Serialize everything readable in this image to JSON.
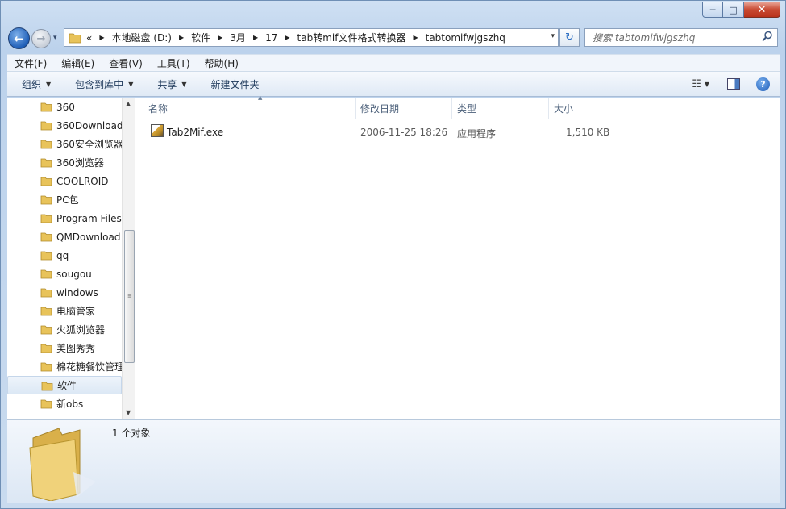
{
  "titlebar": {
    "min_label": "─",
    "max_label": "□",
    "close_label": "✕"
  },
  "nav": {
    "back_glyph": "←",
    "forward_glyph": "→",
    "history_glyph": "▾",
    "refresh_glyph": "↻",
    "address_dropdown_glyph": "▾",
    "address_prefix": "«",
    "breadcrumbs": [
      "本地磁盘 (D:)",
      "软件",
      "3月",
      "17",
      "tab转mif文件格式转换器",
      "tabtomifwjgszhq"
    ],
    "search_placeholder": "搜索 tabtomifwjgszhq",
    "search_icon": "magnifier-icon"
  },
  "menubar": {
    "items": [
      "文件(F)",
      "编辑(E)",
      "查看(V)",
      "工具(T)",
      "帮助(H)"
    ]
  },
  "toolbar": {
    "organize": "组织",
    "include_library": "包含到库中",
    "share": "共享",
    "new_folder": "新建文件夹",
    "help_glyph": "?"
  },
  "navpane": {
    "items": [
      "360",
      "360Download",
      "360安全浏览器",
      "360浏览器",
      "COOLROID",
      "PC包",
      "Program Files",
      "QMDownload",
      "qq",
      "sougou",
      "windows",
      "电脑管家",
      "火狐浏览器",
      "美图秀秀",
      "棉花糖餐饮管理",
      "软件",
      "新obs"
    ],
    "selected": "软件"
  },
  "content": {
    "columns": [
      "名称",
      "修改日期",
      "类型",
      "大小"
    ],
    "files": [
      {
        "name": "Tab2Mif.exe",
        "modified": "2006-11-25 18:26",
        "type": "应用程序",
        "size": "1,510 KB"
      }
    ]
  },
  "details": {
    "count_text": "1 个对象"
  },
  "colors": {
    "accent": "#1f5fb8",
    "close": "#c84a32",
    "folder": "#e8c35a"
  }
}
